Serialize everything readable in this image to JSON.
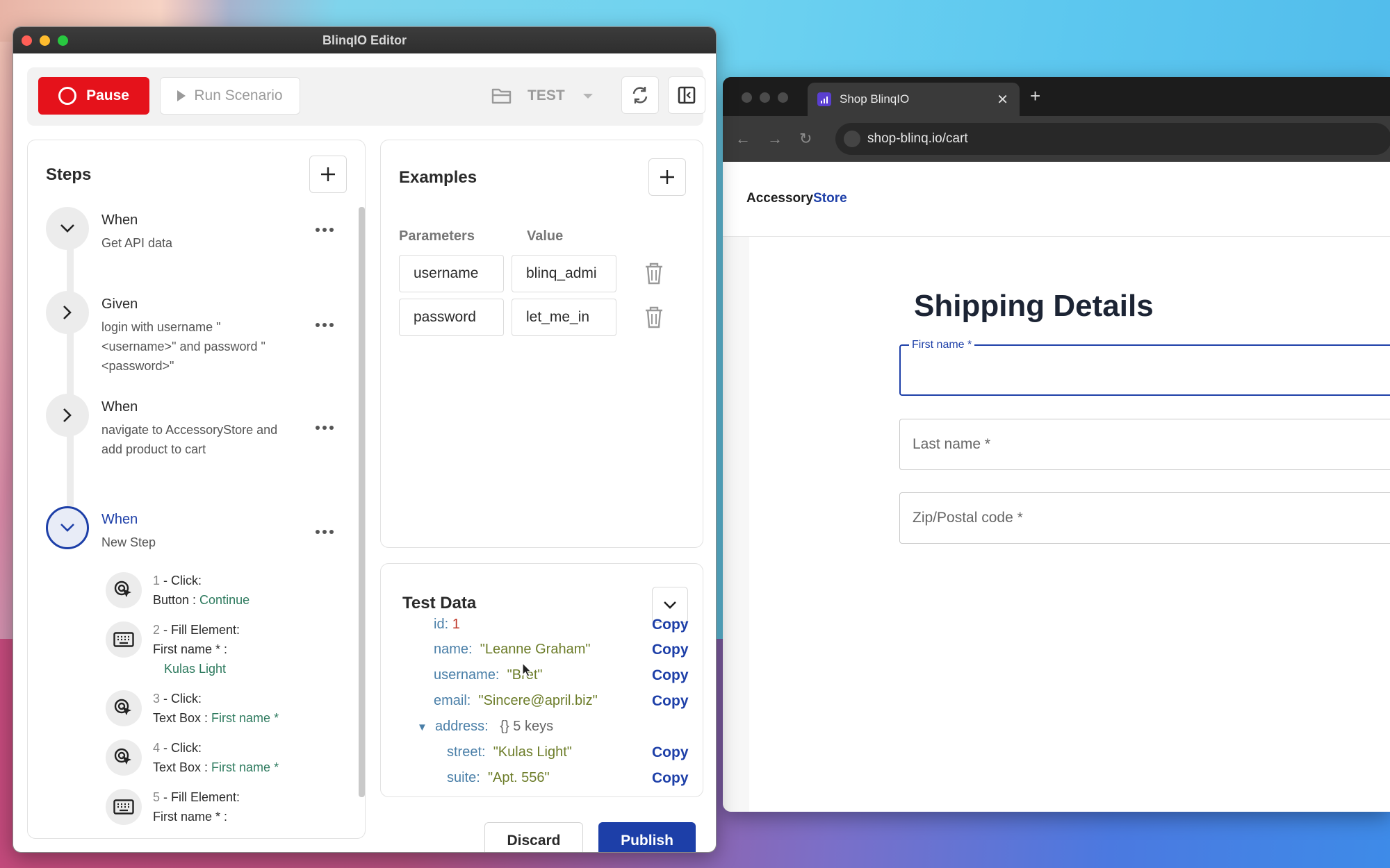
{
  "editor": {
    "window_title": "BlinqIO Editor",
    "toolbar": {
      "pause_label": "Pause",
      "run_label": "Run Scenario",
      "env_label": "TEST"
    },
    "steps": {
      "title": "Steps",
      "items": [
        {
          "keyword": "When",
          "text": "Get API data"
        },
        {
          "keyword": "Given",
          "text": "login with username \"<username>\" and password \"<password>\""
        },
        {
          "keyword": "When",
          "text": "navigate to AccessoryStore and add product to cart"
        },
        {
          "keyword": "When",
          "text": "New Step"
        }
      ],
      "substeps": [
        {
          "num": "1",
          "action": " - Click:",
          "target_type": "Button : ",
          "target": "Continue"
        },
        {
          "num": "2",
          "action": " - Fill Element:",
          "target": "First name * :",
          "value": "Kulas Light"
        },
        {
          "num": "3",
          "action": " - Click:",
          "target_type": "Text Box : ",
          "target": "First name *"
        },
        {
          "num": "4",
          "action": " - Click:",
          "target_type": "Text Box : ",
          "target": "First name *"
        },
        {
          "num": "5",
          "action": " - Fill Element:",
          "target": "First name * :"
        }
      ]
    },
    "examples": {
      "title": "Examples",
      "col_params": "Parameters",
      "col_value": "Value",
      "rows": [
        {
          "param": "username",
          "value": "blinq_admi"
        },
        {
          "param": "password",
          "value": "let_me_in"
        }
      ]
    },
    "test_data": {
      "title": "Test Data",
      "partial_key": "id:",
      "partial_value": "1",
      "rows": [
        {
          "key": "name:",
          "value": "\"Leanne Graham\"",
          "copy": "Copy"
        },
        {
          "key": "username:",
          "value": "\"Bret\"",
          "copy": "Copy"
        },
        {
          "key": "email:",
          "value": "\"Sincere@april.biz\"",
          "copy": "Copy"
        },
        {
          "key": "address:",
          "meta": "{} 5 keys"
        },
        {
          "key": "street:",
          "value": "\"Kulas Light\"",
          "copy": "Copy"
        },
        {
          "key": "suite:",
          "value": "\"Apt. 556\"",
          "copy": "Copy"
        }
      ],
      "first_copy": "Copy"
    },
    "discard_label": "Discard",
    "publish_label": "Publish"
  },
  "browser": {
    "tab_title": "Shop BlinqIO",
    "url": "shop-blinq.io/cart",
    "logo_part1": "Accessory",
    "logo_part2": "Store",
    "page_title": "Shipping Details",
    "fields": [
      {
        "label": "First name *",
        "focused": true
      },
      {
        "label": "Last name *"
      },
      {
        "label": "Zip/Postal code *"
      }
    ]
  },
  "colors": {
    "accent": "#1d3fa8",
    "pause_red": "#e5121b",
    "param_green": "#2d7a5e"
  }
}
